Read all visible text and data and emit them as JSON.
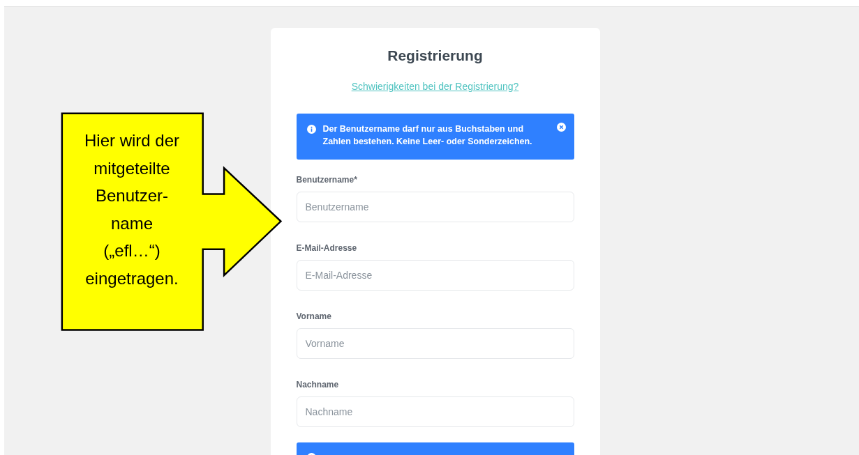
{
  "form": {
    "title": "Registrierung",
    "help_link": "Schwierigkeiten bei der Registrierung?",
    "alert": {
      "text": "Der Benutzername darf nur aus Buchstaben und Zahlen bestehen. Keine Leer- oder Sonderzeichen.",
      "dismissible": true
    },
    "fields": [
      {
        "label": "Benutzername*",
        "placeholder": "Benutzername"
      },
      {
        "label": "E-Mail-Adresse",
        "placeholder": "E-Mail-Adresse"
      },
      {
        "label": "Vorname",
        "placeholder": "Vorname"
      },
      {
        "label": "Nachname",
        "placeholder": "Nachname"
      }
    ]
  },
  "callout": {
    "text": "Hier wird der\nmitgeteilte\nBenutzer-\nname\n(„efl…“)\neingetragen."
  }
}
